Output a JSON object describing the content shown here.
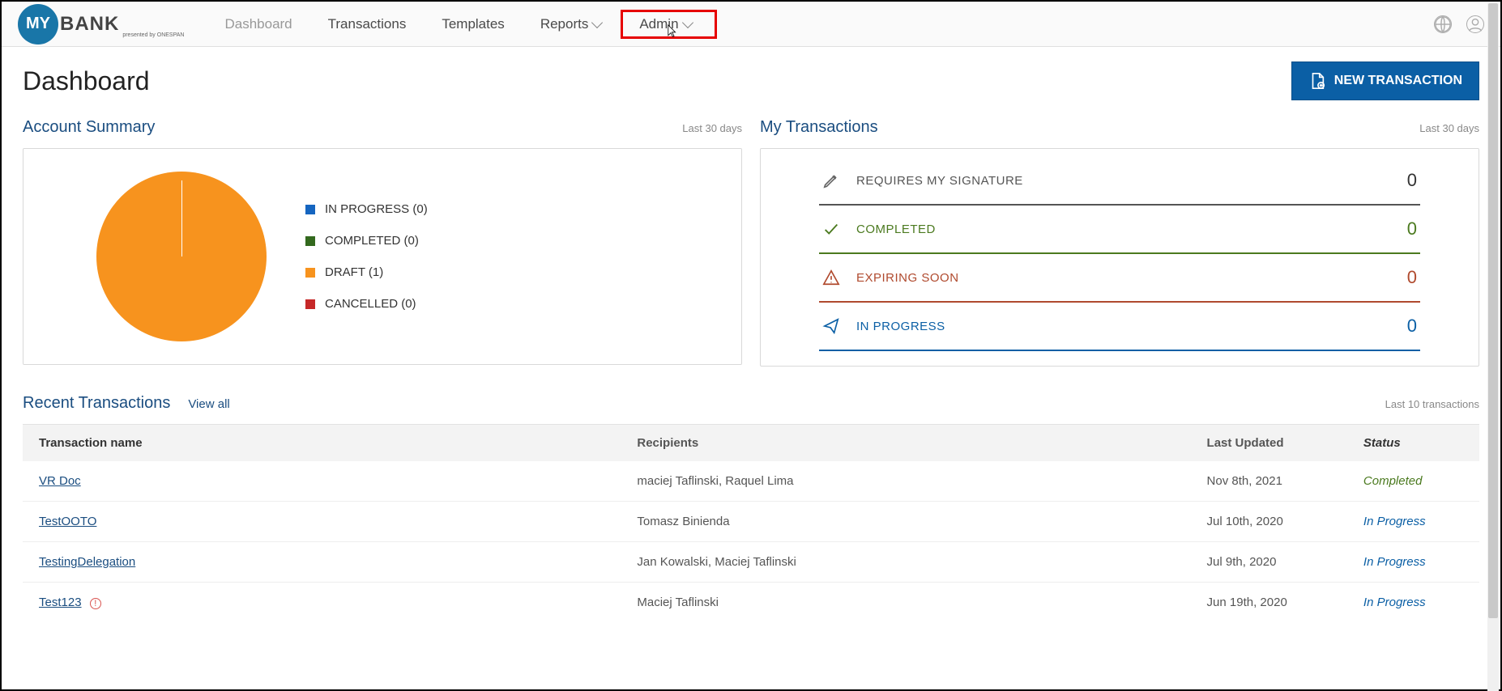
{
  "logo": {
    "circle": "MY",
    "text": "BANK",
    "sub": "presented by ONESPAN"
  },
  "nav": {
    "dashboard": "Dashboard",
    "transactions": "Transactions",
    "templates": "Templates",
    "reports": "Reports",
    "admin": "Admin"
  },
  "page_title": "Dashboard",
  "new_transaction": "NEW TRANSACTION",
  "account_summary": {
    "title": "Account Summary",
    "period": "Last 30 days",
    "legend": {
      "in_progress": {
        "label": "IN PROGRESS (0)",
        "color": "#1565c0"
      },
      "completed": {
        "label": "COMPLETED (0)",
        "color": "#33691e"
      },
      "draft": {
        "label": "DRAFT (1)",
        "color": "#f7931e"
      },
      "cancelled": {
        "label": "CANCELLED (0)",
        "color": "#c62828"
      }
    }
  },
  "my_transactions": {
    "title": "My Transactions",
    "period": "Last 30 days",
    "rows": {
      "requires": {
        "label": "REQUIRES MY SIGNATURE",
        "count": "0",
        "color": "#555",
        "border": "#555"
      },
      "completed": {
        "label": "COMPLETED",
        "count": "0",
        "color": "#4b7a1f",
        "border": "#4b7a1f"
      },
      "expiring": {
        "label": "EXPIRING SOON",
        "count": "0",
        "color": "#b04a2e",
        "border": "#b04a2e"
      },
      "inprogress": {
        "label": "IN PROGRESS",
        "count": "0",
        "color": "#0b5fa5",
        "border": "#0b5fa5"
      }
    }
  },
  "recent": {
    "title": "Recent Transactions",
    "view_all": "View all",
    "sub": "Last 10 transactions",
    "headers": {
      "name": "Transaction name",
      "recip": "Recipients",
      "date": "Last Updated",
      "status": "Status"
    },
    "rows": [
      {
        "name": "VR Doc",
        "recip": "maciej Taflinski, Raquel Lima",
        "date": "Nov 8th, 2021",
        "status": "Completed",
        "status_color": "#4b7a1f",
        "warn": false
      },
      {
        "name": "TestOOTO",
        "recip": "Tomasz Binienda",
        "date": "Jul 10th, 2020",
        "status": "In Progress",
        "status_color": "#0b5fa5",
        "warn": false
      },
      {
        "name": "TestingDelegation",
        "recip": "Jan Kowalski, Maciej Taflinski",
        "date": "Jul 9th, 2020",
        "status": "In Progress",
        "status_color": "#0b5fa5",
        "warn": false
      },
      {
        "name": "Test123",
        "recip": "Maciej Taflinski",
        "date": "Jun 19th, 2020",
        "status": "In Progress",
        "status_color": "#0b5fa5",
        "warn": true
      }
    ]
  },
  "chart_data": {
    "type": "pie",
    "title": "Account Summary",
    "series": [
      {
        "name": "IN PROGRESS",
        "value": 0,
        "color": "#1565c0"
      },
      {
        "name": "COMPLETED",
        "value": 0,
        "color": "#33691e"
      },
      {
        "name": "DRAFT",
        "value": 1,
        "color": "#f7931e"
      },
      {
        "name": "CANCELLED",
        "value": 0,
        "color": "#c62828"
      }
    ]
  }
}
